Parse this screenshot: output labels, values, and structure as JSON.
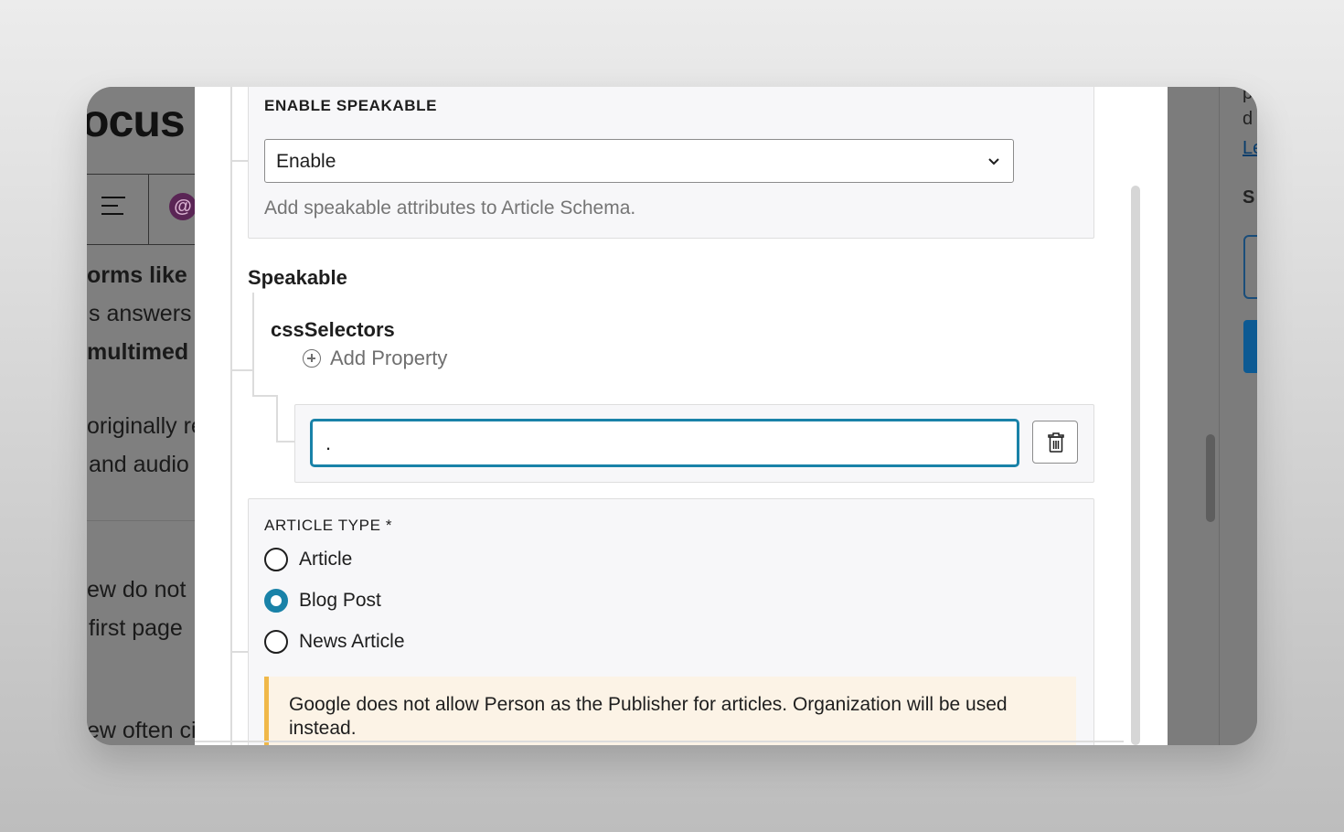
{
  "editor": {
    "title_fragment": "ocus",
    "title_fragment2": "",
    "lines": [
      "orms like",
      "s answers",
      "multimed",
      "originally re",
      "and audio",
      "ew do not",
      "first page",
      "ew often ci"
    ]
  },
  "modal": {
    "enable_speakable": {
      "label": "ENABLE SPEAKABLE",
      "selected": "Enable",
      "help": "Add speakable attributes to Article Schema."
    },
    "speakable": {
      "heading": "Speakable",
      "css_selectors_label": "cssSelectors",
      "add_property_label": "Add Property",
      "selector_value": "."
    },
    "article_type": {
      "label": "ARTICLE TYPE *",
      "options": [
        "Article",
        "Blog Post",
        "News Article"
      ],
      "selected": "Blog Post"
    },
    "notice": "Google does not allow Person as the Publisher for articles. Organization will be used instead."
  },
  "right_sidebar": {
    "fragments": [
      "p",
      "d",
      "Le",
      "S"
    ]
  },
  "colors": {
    "accent": "#1982a8",
    "notice_border": "#f0b849",
    "notice_bg": "#fcf3e6"
  },
  "icons": [
    "chevron-down-icon",
    "add-circle-icon",
    "trash-icon"
  ]
}
